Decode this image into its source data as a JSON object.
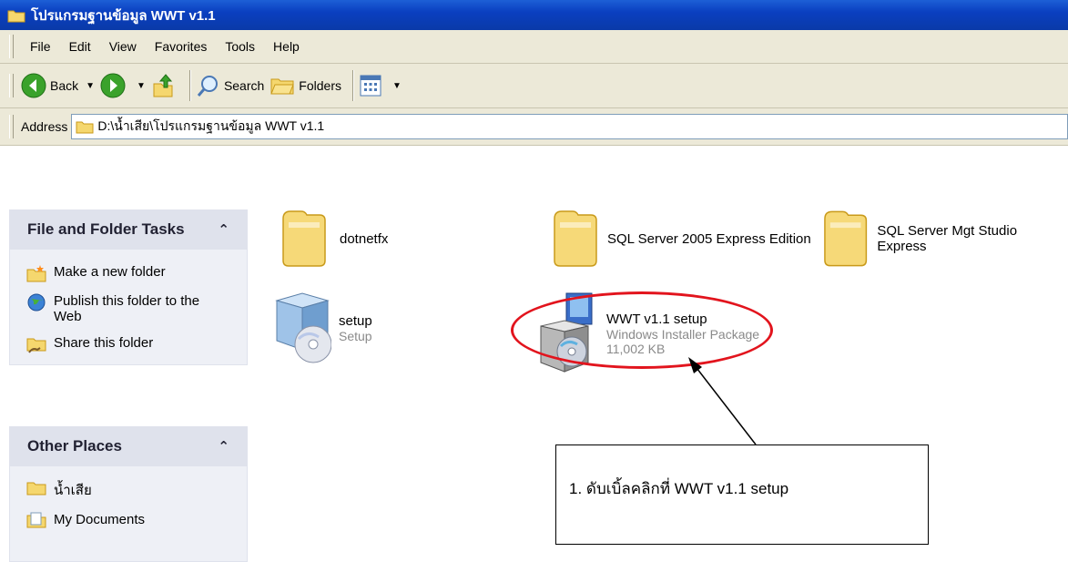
{
  "window": {
    "title": "โปรแกรมฐานข้อมูล WWT v1.1"
  },
  "menu": [
    "File",
    "Edit",
    "View",
    "Favorites",
    "Tools",
    "Help"
  ],
  "toolbar": {
    "back": "Back",
    "search": "Search",
    "folders": "Folders"
  },
  "address": {
    "label": "Address",
    "path": "D:\\น้ำเสีย\\โปรแกรมฐานข้อมูล WWT v1.1"
  },
  "task_pane": {
    "file_tasks": {
      "title": "File and Folder Tasks",
      "items": [
        "Make a new folder",
        "Publish this folder to the Web",
        "Share this folder"
      ]
    },
    "other_places": {
      "title": "Other Places",
      "items": [
        "น้ำเสีย",
        "My Documents"
      ]
    }
  },
  "files": {
    "dotnetfx": {
      "name": "dotnetfx"
    },
    "sql_express": {
      "name": "SQL Server 2005 Express Edition"
    },
    "sql_mgt": {
      "name": "SQL Server Mgt Studio Express"
    },
    "setup": {
      "name": "setup",
      "type": "Setup"
    },
    "wwt_setup": {
      "name": "WWT v1.1 setup",
      "type": "Windows Installer Package",
      "size": "11,002 KB"
    }
  },
  "annotation": {
    "text": "1. ดับเบิ้ลคลิกที่ WWT v1.1 setup"
  },
  "colors": {
    "title_bar": "#0a3fc0",
    "highlight": "#e2141d",
    "pane": "#eef0f6"
  }
}
